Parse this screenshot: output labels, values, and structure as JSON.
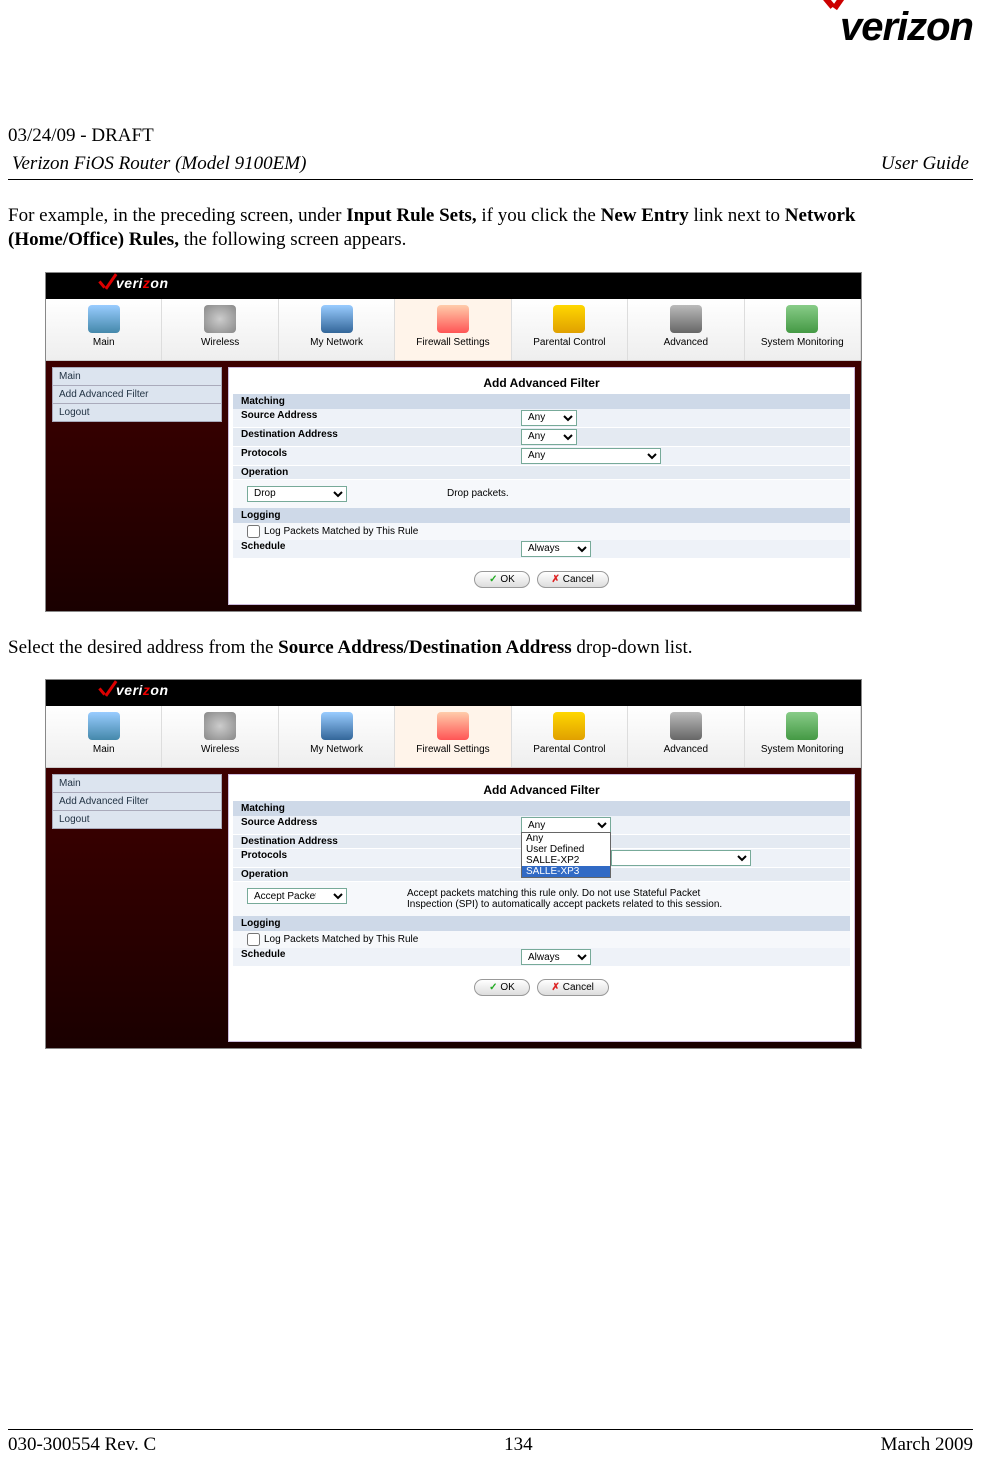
{
  "header": {
    "draft_line": "03/24/09 - DRAFT",
    "product": "Verizon FiOS Router (Model 9100EM)",
    "doc_type": "User Guide",
    "logo_text": "verizon"
  },
  "paragraphs": {
    "p1_a": "For example, in the preceding screen, under ",
    "p1_b": "Input Rule Sets,",
    "p1_c": " if you click the ",
    "p1_d": "New Entry",
    "p1_e": "  link next to ",
    "p1_f": "Network (Home/Office) Rules,",
    "p1_g": " the following screen appears.",
    "p2_a": "Select the desired address from the ",
    "p2_b": "Source Address/Destination Address",
    "p2_c": " drop-down list."
  },
  "router_ui": {
    "logo": "verizon",
    "nav": {
      "main": "Main",
      "wireless": "Wireless",
      "my_network": "My Network",
      "firewall": "Firewall Settings",
      "parental": "Parental Control",
      "advanced": "Advanced",
      "sysmon": "System Monitoring"
    },
    "sidebar": {
      "main": "Main",
      "add_filter": "Add Advanced Filter",
      "logout": "Logout"
    },
    "panel_title": "Add Advanced Filter",
    "sections": {
      "matching": "Matching",
      "logging": "Logging"
    },
    "rows": {
      "source_address": "Source Address",
      "destination_address": "Destination Address",
      "protocols": "Protocols",
      "operation": "Operation",
      "schedule": "Schedule"
    },
    "values": {
      "any": "Any",
      "always": "Always"
    },
    "operation1": {
      "select": "Drop",
      "desc": "Drop packets."
    },
    "operation2": {
      "select": "Accept Packet",
      "desc": "Accept packets matching this rule only. Do not use Stateful Packet Inspection (SPI) to automatically accept packets related to this session."
    },
    "log_checkbox": "Log Packets Matched by This Rule",
    "dropdown_options": {
      "o1": "Any",
      "o2": "User Defined",
      "o3": "SALLE-XP2",
      "o4": "SALLE-XP3"
    },
    "buttons": {
      "ok": "OK",
      "cancel": "Cancel"
    }
  },
  "footer": {
    "left": "030-300554 Rev. C",
    "center": "134",
    "right": "March 2009"
  }
}
